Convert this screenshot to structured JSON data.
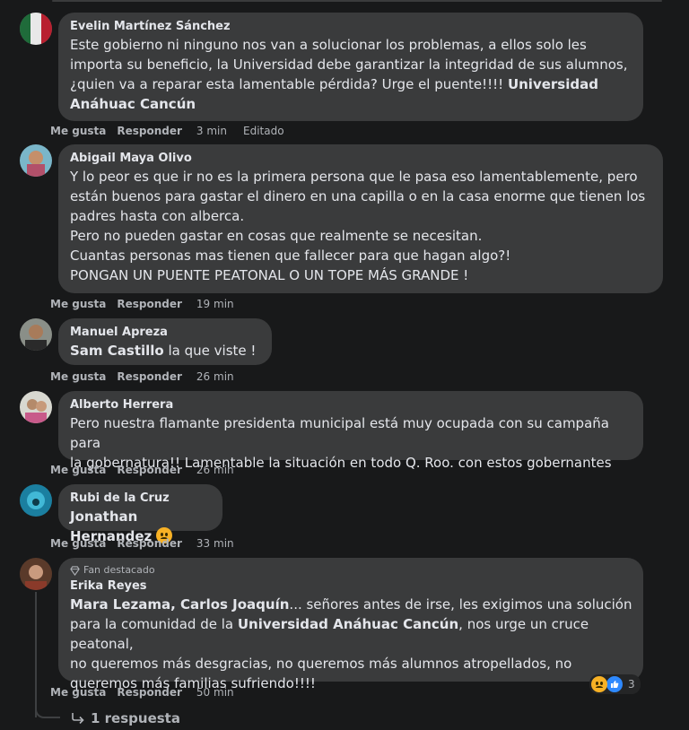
{
  "comments": [
    {
      "name": "Evelin Martínez Sánchez",
      "text": "Este gobierno ni ninguno nos van a solucionar los problemas, a ellos solo les\nimporta su beneficio, la Universidad debe garantizar la integridad de sus alumnos,\n¿quien va a reparar esta lamentable pérdida? Urge el puente!!!! ",
      "tag": "Universidad\nAnáhuac Cancún",
      "like": "Me gusta",
      "reply": "Responder",
      "time": "3 min",
      "edited": "Editado"
    },
    {
      "name": "Abigail Maya Olivo",
      "text": "Y lo peor es que ir no es la primera persona que le pasa eso lamentablemente, pero\nestán buenos para gastar el dinero en una capilla o en la casa enorme que tienen los\npadres hasta con alberca.\nPero no pueden gastar en cosas que realmente se necesitan.\nCuantas personas mas tienen que fallecer para que hagan algo?!\nPONGAN UN PUENTE PEATONAL O UN TOPE MÁS GRANDE !",
      "like": "Me gusta",
      "reply": "Responder",
      "time": "19 min"
    },
    {
      "name": "Manuel Apreza",
      "tag": "Sam Castillo",
      "text": " la que viste !",
      "like": "Me gusta",
      "reply": "Responder",
      "time": "26 min"
    },
    {
      "name": "Alberto Herrera",
      "text": "Pero nuestra flamante presidenta municipal está muy ocupada con su campaña para\nla gobernatura!! Lamentable la situación en todo Q. Roo. con estos gobernantes",
      "like": "Me gusta",
      "reply": "Responder",
      "time": "26 min"
    },
    {
      "name": "Rubi de la Cruz",
      "tag": "Jonathan Hernandez",
      "like": "Me gusta",
      "reply": "Responder",
      "time": "33 min"
    },
    {
      "badge": "Fan destacado",
      "name": "Erika Reyes",
      "tag1": "Mara Lezama, Carlos Joaquín",
      "text1": "... señores antes de irse, les exigimos una solución\npara la comunidad de la ",
      "tag2": "Universidad Anáhuac Cancún",
      "text2": ", nos urge un cruce peatonal,\nno queremos más desgracias, no queremos más alumnos atropellados, no\nqueremos más familias sufriendo!!!!",
      "reaction_count": "3",
      "like": "Me gusta",
      "reply": "Responder",
      "time": "50 min"
    }
  ],
  "replies_label": "1 respuesta",
  "icons": {
    "sad": "sad-reaction-icon",
    "like": "like-reaction-icon",
    "badge": "diamond-icon",
    "reply_arrow": "reply-arrow-icon"
  }
}
